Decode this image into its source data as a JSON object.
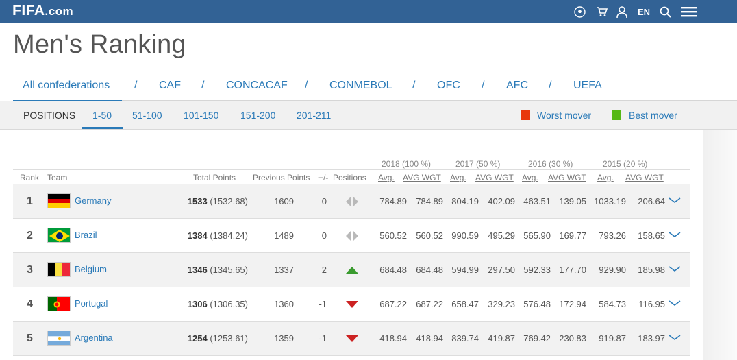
{
  "header": {
    "logo_main": "FIFA",
    "logo_suffix": ".com",
    "lang": "EN"
  },
  "page_title": "Men's Ranking",
  "confederations": [
    "All confederations",
    "CAF",
    "CONCACAF",
    "CONMEBOL",
    "OFC",
    "AFC",
    "UEFA"
  ],
  "separator": "/",
  "positions": {
    "label": "POSITIONS",
    "tabs": [
      "1-50",
      "51-100",
      "101-150",
      "151-200",
      "201-211"
    ]
  },
  "legend": {
    "worst": "Worst mover",
    "worst_color": "#e8380d",
    "best": "Best mover",
    "best_color": "#56b816"
  },
  "group_headers": [
    "2018 (100 %)",
    "2017 (50 %)",
    "2016 (30 %)",
    "2015 (20 %)"
  ],
  "columns": {
    "rank": "Rank",
    "team": "Team",
    "total": "Total Points",
    "previous": "Previous Points",
    "diff": "+/-",
    "positions": "Positions",
    "avg": "Avg.",
    "avg_wgt": "AVG WGT"
  },
  "rows": [
    {
      "rank": "1",
      "team": "Germany",
      "flag": "germany",
      "total": "1533",
      "total_exact": "(1532.68)",
      "previous": "1609",
      "diff": "0",
      "move": "same",
      "y2018_avg": "784.89",
      "y2018_wgt": "784.89",
      "y2017_avg": "804.19",
      "y2017_wgt": "402.09",
      "y2016_avg": "463.51",
      "y2016_wgt": "139.05",
      "y2015_avg": "1033.19",
      "y2015_wgt": "206.64"
    },
    {
      "rank": "2",
      "team": "Brazil",
      "flag": "brazil",
      "total": "1384",
      "total_exact": "(1384.24)",
      "previous": "1489",
      "diff": "0",
      "move": "same",
      "y2018_avg": "560.52",
      "y2018_wgt": "560.52",
      "y2017_avg": "990.59",
      "y2017_wgt": "495.29",
      "y2016_avg": "565.90",
      "y2016_wgt": "169.77",
      "y2015_avg": "793.26",
      "y2015_wgt": "158.65"
    },
    {
      "rank": "3",
      "team": "Belgium",
      "flag": "belgium",
      "total": "1346",
      "total_exact": "(1345.65)",
      "previous": "1337",
      "diff": "2",
      "move": "up",
      "y2018_avg": "684.48",
      "y2018_wgt": "684.48",
      "y2017_avg": "594.99",
      "y2017_wgt": "297.50",
      "y2016_avg": "592.33",
      "y2016_wgt": "177.70",
      "y2015_avg": "929.90",
      "y2015_wgt": "185.98"
    },
    {
      "rank": "4",
      "team": "Portugal",
      "flag": "portugal",
      "total": "1306",
      "total_exact": "(1306.35)",
      "previous": "1360",
      "diff": "-1",
      "move": "down",
      "y2018_avg": "687.22",
      "y2018_wgt": "687.22",
      "y2017_avg": "658.47",
      "y2017_wgt": "329.23",
      "y2016_avg": "576.48",
      "y2016_wgt": "172.94",
      "y2015_avg": "584.73",
      "y2015_wgt": "116.95"
    },
    {
      "rank": "5",
      "team": "Argentina",
      "flag": "argentina",
      "total": "1254",
      "total_exact": "(1253.61)",
      "previous": "1359",
      "diff": "-1",
      "move": "down",
      "y2018_avg": "418.94",
      "y2018_wgt": "418.94",
      "y2017_avg": "839.74",
      "y2017_wgt": "419.87",
      "y2016_avg": "769.42",
      "y2016_wgt": "230.83",
      "y2015_avg": "919.87",
      "y2015_wgt": "183.97"
    }
  ]
}
